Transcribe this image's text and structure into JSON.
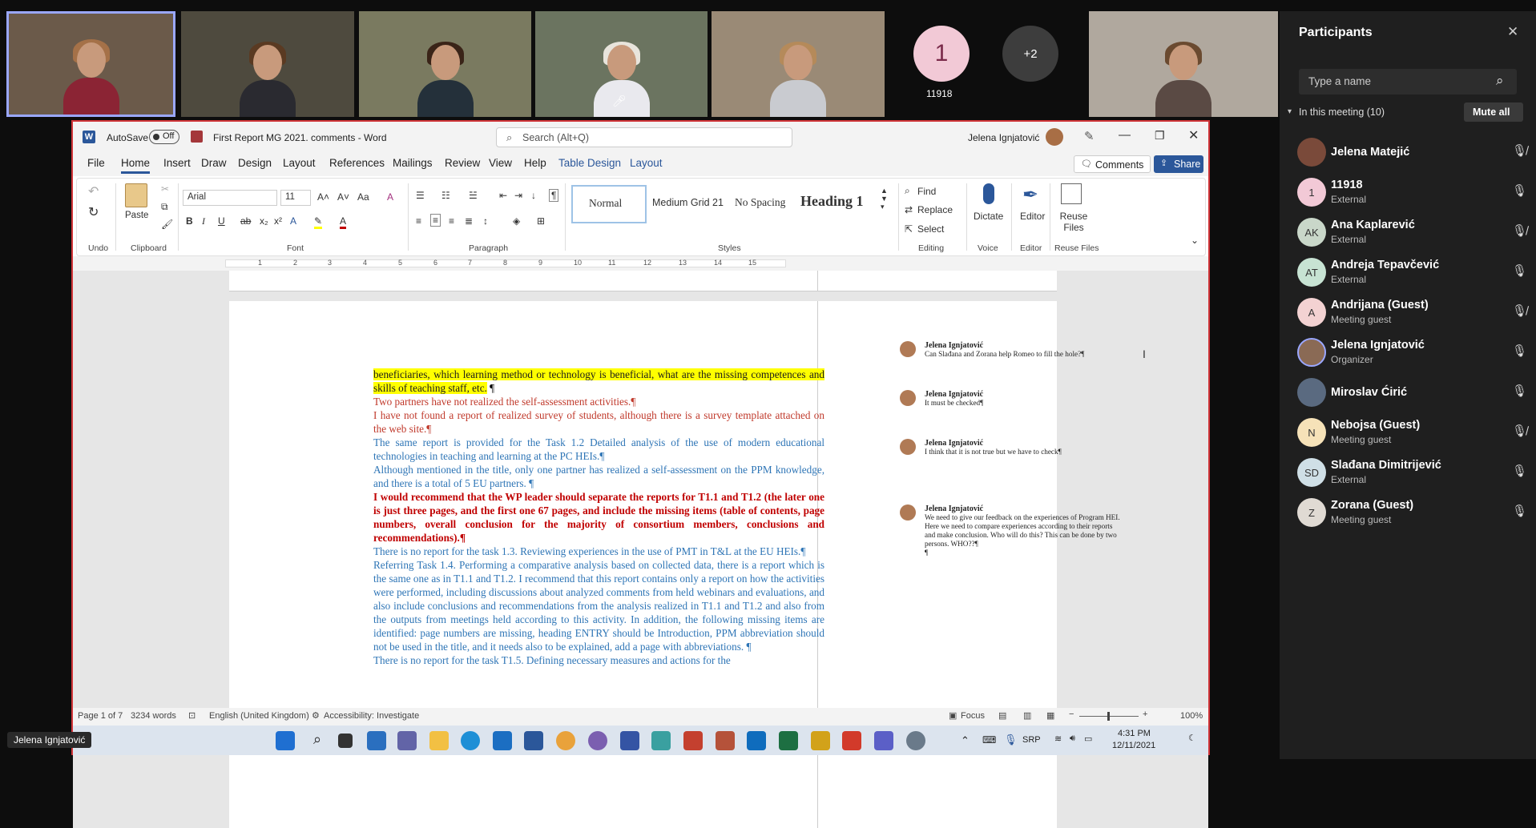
{
  "video": {
    "tiles": [
      {
        "name": "tile-1"
      },
      {
        "name": "tile-2"
      },
      {
        "name": "tile-3"
      },
      {
        "name": "tile-4"
      },
      {
        "name": "tile-5"
      },
      {
        "name": "tile-6"
      }
    ],
    "avatar_11918": {
      "initial": "1",
      "label": "11918"
    },
    "overflow": "+2",
    "self_name": "Jelena Ignjatović"
  },
  "word": {
    "autosave": "AutoSave",
    "autosave_state": "Off",
    "doc_title": "First Report MG 2021. comments  -  Word",
    "search_placeholder": "Search (Alt+Q)",
    "user": "Jelena Ignjatović",
    "tabs": [
      "File",
      "Home",
      "Insert",
      "Draw",
      "Design",
      "Layout",
      "References",
      "Mailings",
      "Review",
      "View",
      "Help",
      "Table Design",
      "Layout"
    ],
    "comments_btn": "Comments",
    "share_btn": "Share",
    "ribbon": {
      "undo": "Undo",
      "paste": "Paste",
      "clipboard": "Clipboard",
      "font_name": "Arial",
      "font_size": "11",
      "font": "Font",
      "paragraph": "Paragraph",
      "styles": [
        "Normal",
        "Medium Grid 21",
        "No Spacing",
        "Heading 1"
      ],
      "styles_label": "Styles",
      "find": "Find",
      "replace": "Replace",
      "select": "Select",
      "editing": "Editing",
      "dictate": "Dictate",
      "voice": "Voice",
      "editor": "Editor",
      "editor_group": "Editor",
      "reuse": "Reuse Files",
      "reuse_group": "Reuse Files"
    },
    "ruler_numbers": [
      "1",
      "2",
      "3",
      "4",
      "5",
      "6",
      "7",
      "8",
      "9",
      "10",
      "11",
      "12",
      "13",
      "14",
      "15"
    ],
    "doc": {
      "p_highlight": "beneficiaries, which learning method or technology is beneficial, what are the missing competences and skills of teaching staff, etc.",
      "p_red1": "Two partners have not realized the self-assessment activities.",
      "p_red2": "I have not found a report of realized survey of students, although there is a survey template attached on the web site.",
      "p_blue1": "The same report is provided for the Task 1.2 Detailed analysis of the use of modern educational technologies in teaching and learning at the PC HEIs.",
      "p_blue2": "Although mentioned in the title, only one partner has realized a self-assessment on the PPM knowledge, and there is a total of 5 EU partners.",
      "p_bold": "I would recommend that the WP leader should separate the reports for T1.1 and T1.2 (the later one is just three pages, and the first one 67 pages, and include the missing items (table of contents, page numbers, overall conclusion for the majority of consortium members, conclusions and recommendations).",
      "p_blue3": "There is no report for the task 1.3. Reviewing experiences in the use of PMT in T&L at the EU HEIs.",
      "p_blue4": "Referring Task 1.4. Performing a comparative analysis based on collected data, there is a report which is the same one as in T1.1 and T1.2. I recommend that this report contains only a report on how the activities were performed, including discussions about analyzed comments from held webinars and evaluations, and also include conclusions and recommendations from the analysis realized in T1.1 and T1.2 and also from the outputs from meetings held according to this activity. In addition, the following missing items are identified: page numbers are missing, heading ENTRY should be Introduction, PPM abbreviation should not be used in the title, and it needs also to be explained, add a page with abbreviations.",
      "p_blue5": "There is no report for the task T1.5. Defining necessary measures and actions for the"
    },
    "comments": [
      {
        "author": "Jelena Ignjatović",
        "text": "Can Slađana and Zorana help Romeo to fill the hole?"
      },
      {
        "author": "Jelena Ignjatović",
        "text": "It must be checked"
      },
      {
        "author": "Jelena Ignjatović",
        "text": "I think that it is not true but we have to check"
      },
      {
        "author": "Jelena Ignjatović",
        "text": "We need to give our feedback on the experiences of Program HEI. Here we need to compare experiences according to their reports and make conclusion. Who will do this? This can be done by two persons. WHO??"
      }
    ],
    "status": {
      "page": "Page 1 of 7",
      "words": "3234 words",
      "language": "English (United Kingdom)",
      "accessibility": "Accessibility: Investigate",
      "focus": "Focus",
      "zoom": "100%"
    },
    "taskbar": {
      "lang": "SRP",
      "time": "4:31 PM",
      "date": "12/11/2021"
    }
  },
  "participants": {
    "title": "Participants",
    "search_placeholder": "Type a name",
    "section": "In this meeting (10)",
    "mute_all": "Mute all",
    "list": [
      {
        "name": "Jelena Matejić",
        "sub": "",
        "initials": "",
        "color": "#7a4a3a"
      },
      {
        "name": "11918",
        "sub": "External",
        "initials": "1",
        "color": "#f2c9d6"
      },
      {
        "name": "Ana Kaplarević",
        "sub": "External",
        "initials": "AK",
        "color": "#c9d7c9"
      },
      {
        "name": "Andreja Tepavčević",
        "sub": "External",
        "initials": "AT",
        "color": "#c7e3d3"
      },
      {
        "name": "Andrijana (Guest)",
        "sub": "Meeting guest",
        "initials": "A",
        "color": "#f3d2d2"
      },
      {
        "name": "Jelena Ignjatović",
        "sub": "Organizer",
        "initials": "",
        "color": "#8a6a55"
      },
      {
        "name": "Miroslav Ćirić",
        "sub": "",
        "initials": "",
        "color": "#5a6a80"
      },
      {
        "name": "Nebojsa (Guest)",
        "sub": "Meeting guest",
        "initials": "N",
        "color": "#f6e2b8"
      },
      {
        "name": "Slađana Dimitrijević",
        "sub": "External",
        "initials": "SD",
        "color": "#cfdfe6"
      },
      {
        "name": "Zorana (Guest)",
        "sub": "Meeting guest",
        "initials": "Z",
        "color": "#e0dad3"
      }
    ]
  }
}
